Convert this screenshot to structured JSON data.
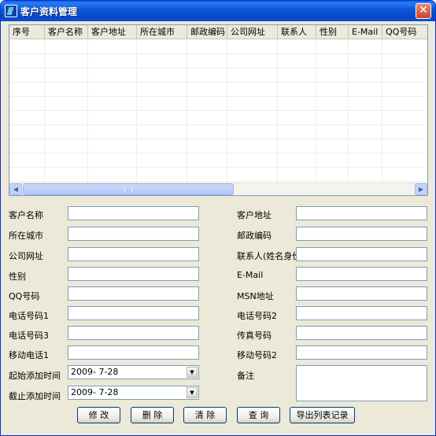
{
  "window": {
    "title": "客户资料管理",
    "close_label": "✕"
  },
  "table": {
    "columns": [
      "序号",
      "客户名称",
      "客户地址",
      "所在城市",
      "邮政编码",
      "公司网址",
      "联系人",
      "性别",
      "E-Mail",
      "QQ号码"
    ]
  },
  "form": {
    "customer_name": {
      "label": "客户名称",
      "value": ""
    },
    "customer_address": {
      "label": "客户地址",
      "value": ""
    },
    "city": {
      "label": "所在城市",
      "value": ""
    },
    "postal_code": {
      "label": "邮政编码",
      "value": ""
    },
    "website": {
      "label": "公司网址",
      "value": ""
    },
    "contact": {
      "label": "联系人(姓名身份",
      "value": ""
    },
    "gender": {
      "label": "性别",
      "value": ""
    },
    "email": {
      "label": "E-Mail",
      "value": ""
    },
    "qq": {
      "label": "QQ号码",
      "value": ""
    },
    "msn": {
      "label": "MSN地址",
      "value": ""
    },
    "phone1": {
      "label": "电话号码1",
      "value": ""
    },
    "phone2": {
      "label": "电话号码2",
      "value": ""
    },
    "phone3": {
      "label": "电话号码3",
      "value": ""
    },
    "fax": {
      "label": "传真号码",
      "value": ""
    },
    "mobile1": {
      "label": "移动电话1",
      "value": ""
    },
    "mobile2": {
      "label": "移动号码2",
      "value": ""
    },
    "start_date": {
      "label": "起始添加时间",
      "value": "2009- 7-28"
    },
    "end_date": {
      "label": "截止添加时间",
      "value": "2009- 7-28"
    },
    "notes": {
      "label": "备注",
      "value": ""
    }
  },
  "buttons": {
    "edit": "修 改",
    "delete": "删 除",
    "clear": "清 除",
    "query": "查 询",
    "export": "导出列表记录"
  },
  "icons": {
    "scroll_left": "◀",
    "scroll_right": "▶",
    "dropdown": "▼"
  }
}
